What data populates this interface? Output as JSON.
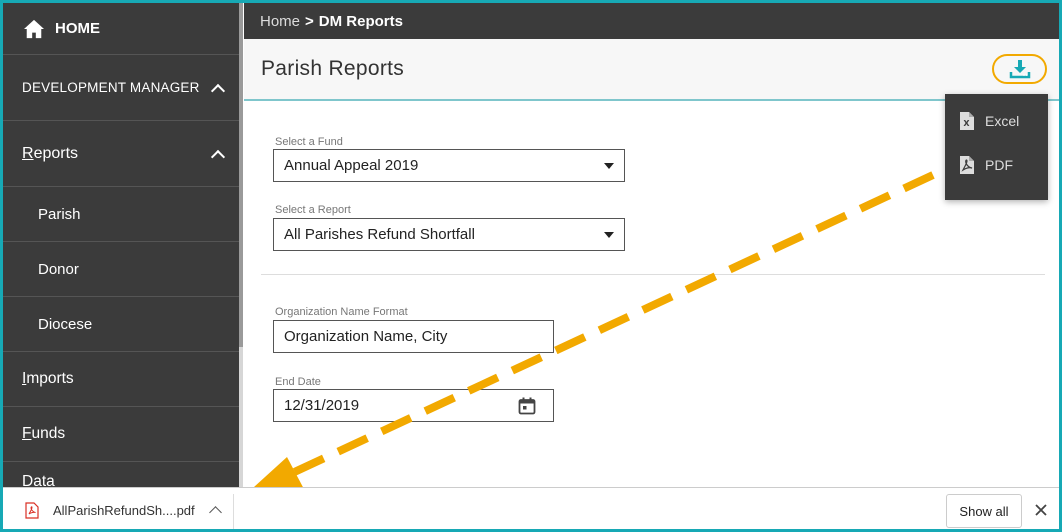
{
  "sidebar": {
    "home": "HOME",
    "development_manager": "DEVELOPMENT MANAGER",
    "reports_first": "R",
    "reports_rest": "eports",
    "parish": "Parish",
    "donor": "Donor",
    "diocese": "Diocese",
    "imports_first": "I",
    "imports_rest": "mports",
    "funds_first": "F",
    "funds_rest": "unds",
    "partial_item": "Data"
  },
  "breadcrumb": {
    "home": "Home",
    "separator": ">",
    "current": "DM Reports"
  },
  "header": {
    "title": "Parish Reports"
  },
  "form": {
    "fund_label": "Select a Fund",
    "fund_value": "Annual Appeal 2019",
    "report_label": "Select a Report",
    "report_value": "All Parishes Refund Shortfall",
    "org_format_label": "Organization Name Format",
    "org_format_value": "Organization Name, City",
    "end_date_label": "End Date",
    "end_date_value": "12/31/2019"
  },
  "download_menu": {
    "excel": "Excel",
    "pdf": "PDF"
  },
  "download_bar": {
    "file_name": "AllParishRefundSh....pdf",
    "show_all": "Show all"
  },
  "colors": {
    "accent": "#17a9b5",
    "highlight": "#f2a900",
    "sidebar_bg": "#3b3b3b"
  }
}
